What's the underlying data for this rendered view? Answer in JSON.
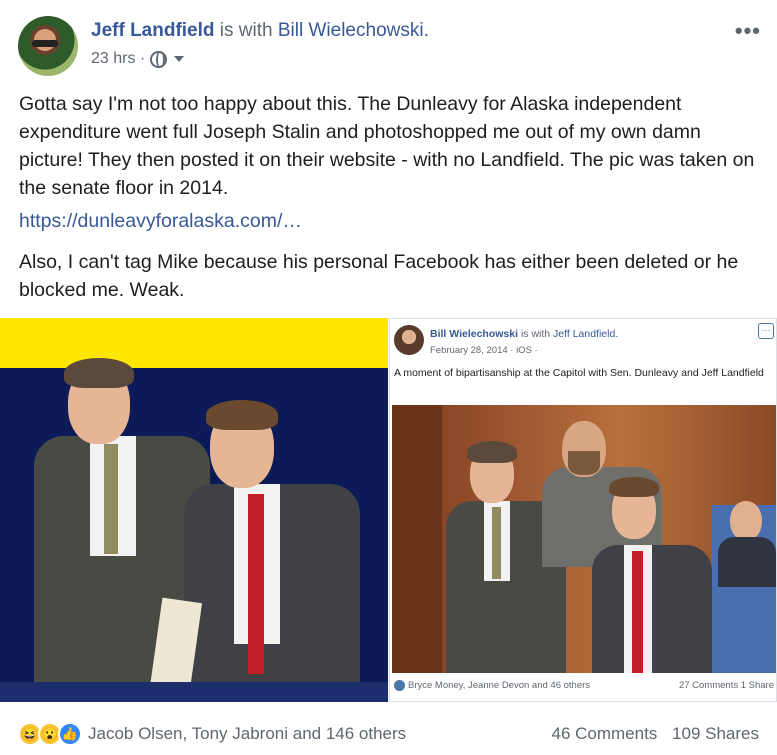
{
  "header": {
    "author": "Jeff Landfield",
    "with_text": "is with",
    "tagged": "Bill Wielechowski.",
    "time": "23 hrs ·",
    "more_icon": "more-dots-icon",
    "privacy_icon": "globe-icon"
  },
  "body": {
    "paragraph1": "Gotta say I'm not too happy about this. The Dunleavy for Alaska independent expenditure went full Joseph Stalin and photoshopped me out of my own damn picture! They then posted it on their website - with no Landfield. The pic was taken on the senate floor in 2014.",
    "link": "https://dunleavyforalaska.com/…",
    "paragraph2": "Also, I can't tag Mike because his personal Facebook has either been deleted or he blocked me. Weak."
  },
  "embedded_post": {
    "author": "Bill Wielechowski",
    "with_text": "is with",
    "tagged": "Jeff Landfield.",
    "meta": "February 28, 2014 · iOS · ",
    "more_label": "···",
    "caption": "A moment of bipartisanship at the Capitol with Sen. Dunleavy and Jeff Landfield",
    "likes": "Bryce Money, Jeanne Devon and 46 others",
    "comments_shares": "27 Comments  1 Share"
  },
  "footer": {
    "reactions_text": "Jacob Olsen, Tony Jabroni and 146 others",
    "comments": "46 Comments",
    "shares": "109 Shares",
    "reaction_icons": [
      "haha-icon",
      "wow-icon",
      "like-icon"
    ]
  },
  "colors": {
    "link_blue": "#385898",
    "banner_yellow": "#ffe600",
    "banner_navy": "#0c1b57",
    "meta_gray": "#606770"
  }
}
